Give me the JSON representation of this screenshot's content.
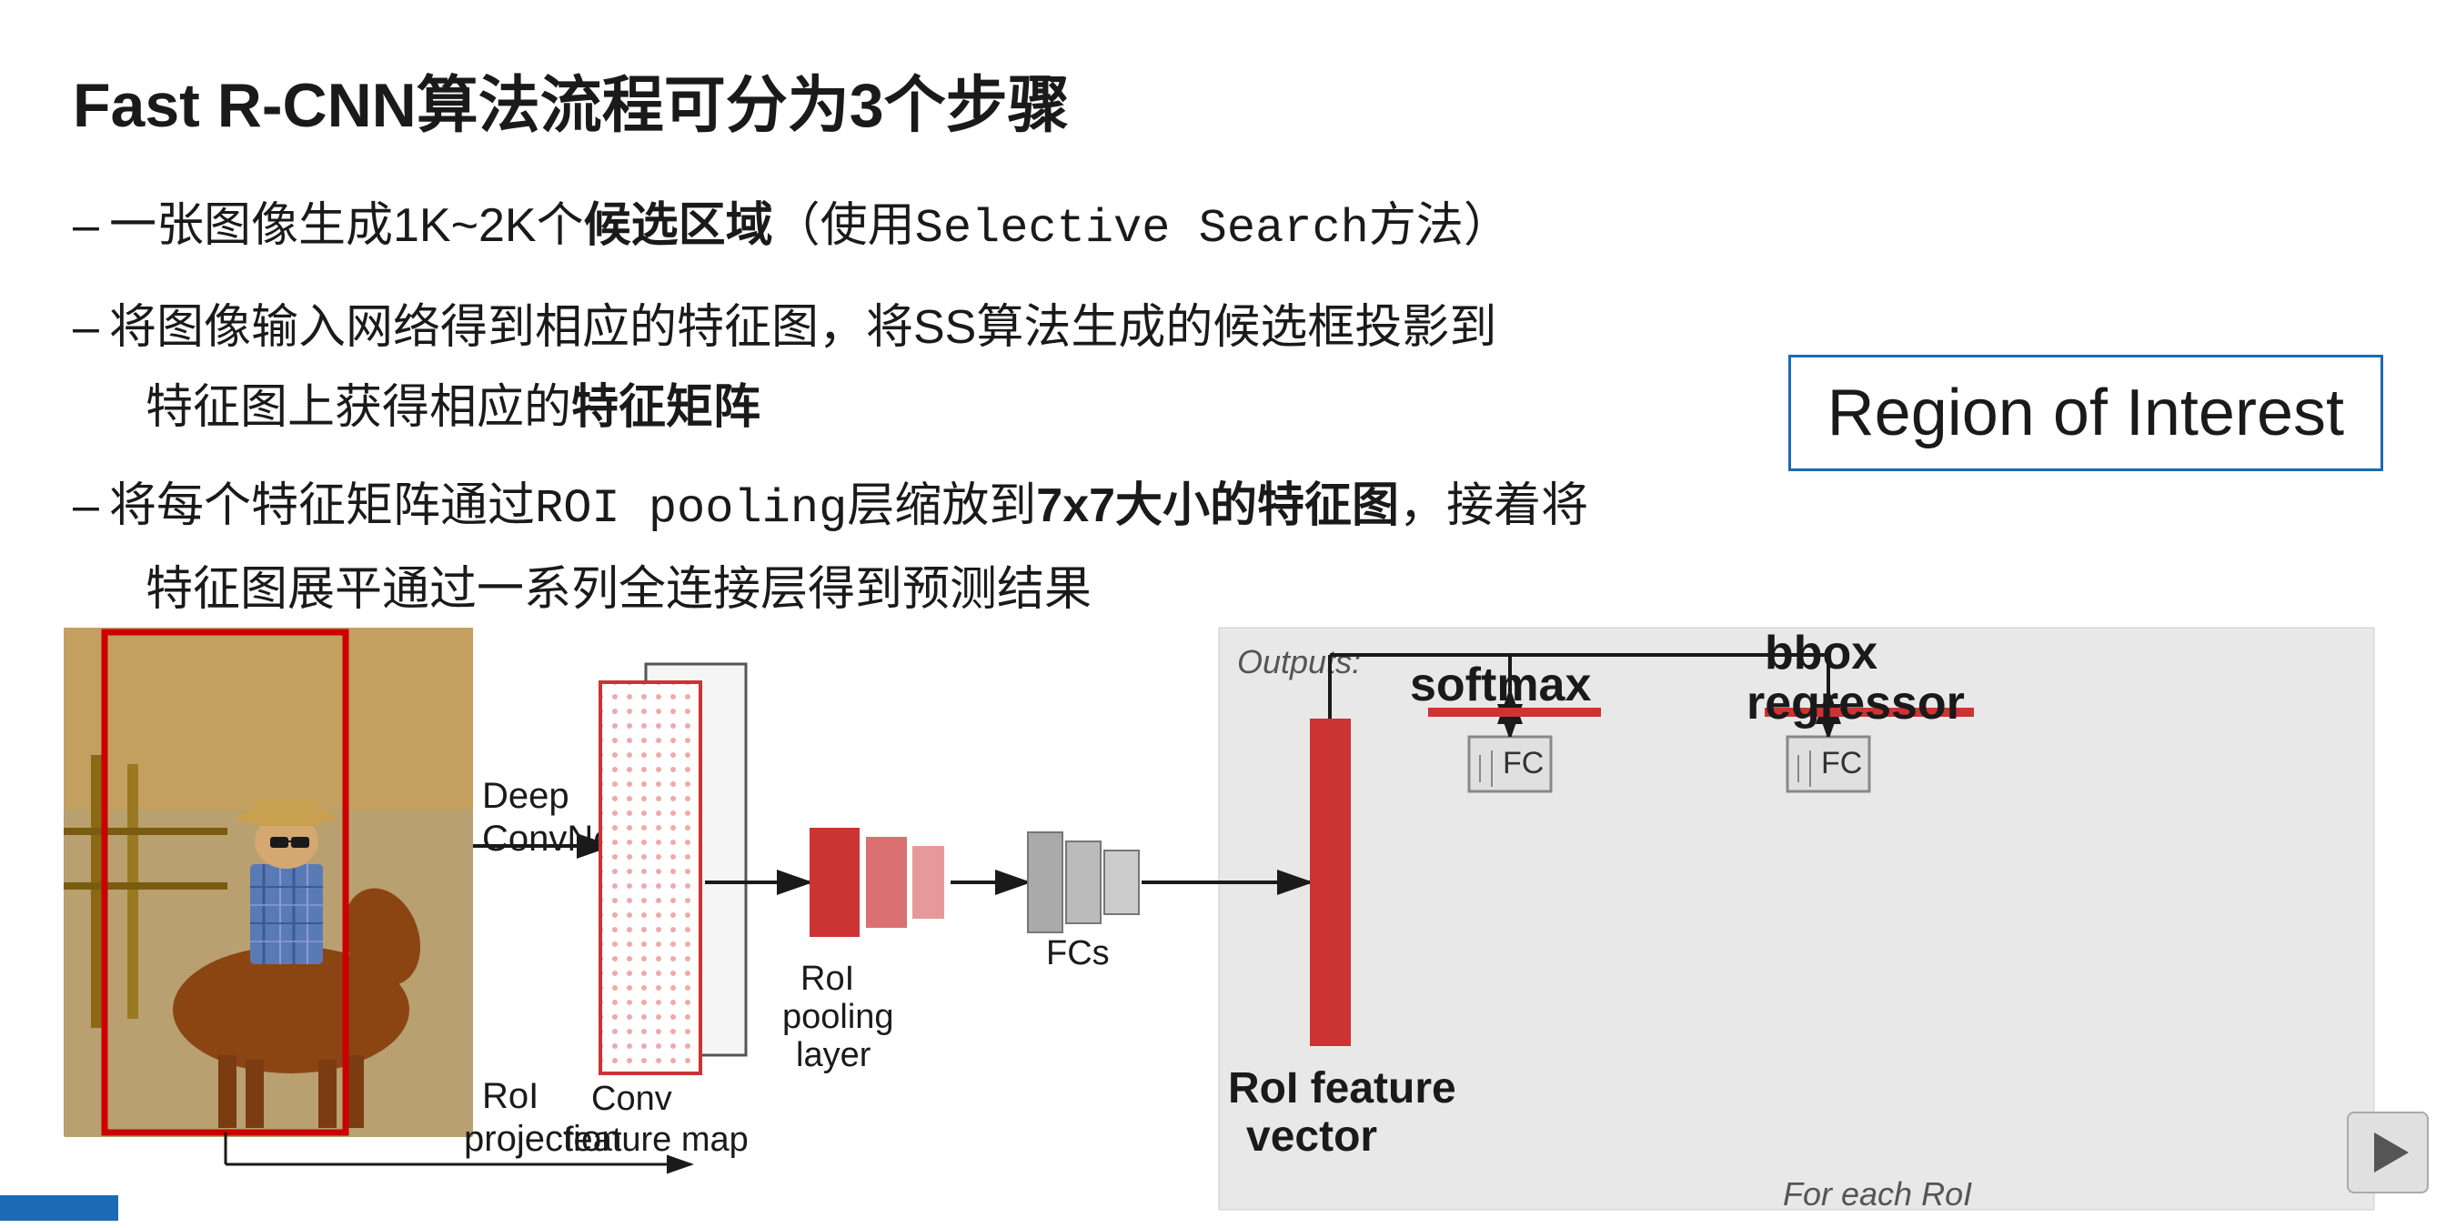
{
  "title": "Fast R-CNN算法流程可分为3个步骤",
  "bullets": [
    {
      "main": "一张图像生成1K~2K个",
      "bold": "候选区域",
      "rest": "(使用Selective Search方法）"
    },
    {
      "main": "将图像输入网络得到相应的特征图，将SS算法生成的候选框投影到",
      "sub": "特征图上获得相应的",
      "subBold": "特征矩阵"
    },
    {
      "mainPre": "将每个特征矩阵通过ROI pooling层缩放到",
      "bold": "7x7大小的特征图",
      "mainPost": "，接着将",
      "sub": "特征图展平通过一系列全连接层得到预测结果"
    }
  ],
  "roi_box_label": "Region of Interest",
  "diagram": {
    "deep_convnet": "Deep\nConvNet",
    "roi_projection": "RoI\nprojection",
    "conv_feature_map": "Conv\nfeature map",
    "roi_pooling_layer": "RoI\npooling\nlayer",
    "fcs_label": "FCs",
    "fc_label": "FC",
    "softmax_label": "softmax",
    "bbox_label": "bbox",
    "regressor_label": "regressor",
    "roi_feature_vector": "RoI feature\nvector",
    "outputs_label": "Outputs:",
    "for_each_roi": "For each RoI"
  },
  "play_button_label": "play"
}
